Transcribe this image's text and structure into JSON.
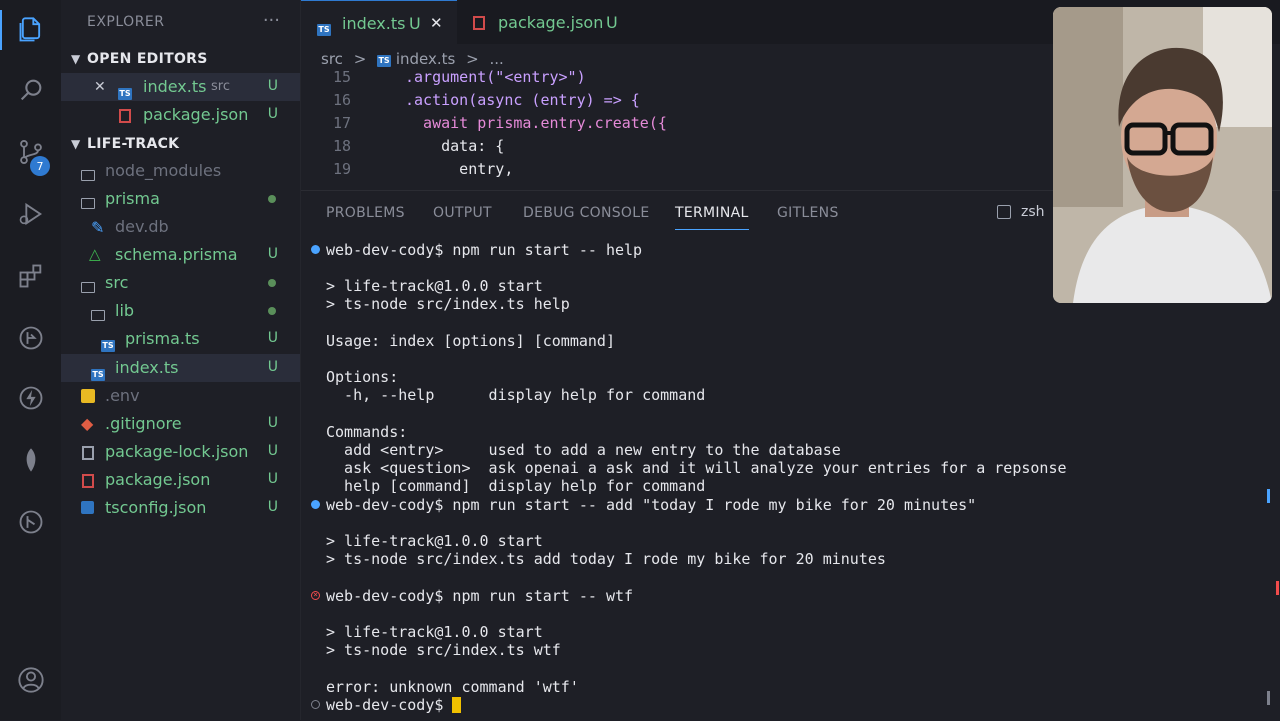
{
  "activity_bar": {
    "scm_badge": "7"
  },
  "sidebar": {
    "title": "EXPLORER",
    "more": "···",
    "open_editors": {
      "title": "OPEN EDITORS",
      "items": [
        {
          "close": "✕",
          "name": "index.ts",
          "hint": "src",
          "status": "U"
        },
        {
          "name": "package.json",
          "status": "U"
        }
      ]
    },
    "project": {
      "title": "LIFE-TRACK",
      "items": [
        {
          "name": "node_modules",
          "status": ""
        },
        {
          "name": "prisma",
          "status": "dot"
        },
        {
          "name": "dev.db",
          "status": ""
        },
        {
          "name": "schema.prisma",
          "status": "U"
        },
        {
          "name": "src",
          "status": "dot"
        },
        {
          "name": "lib",
          "status": "dot"
        },
        {
          "name": "prisma.ts",
          "status": "U"
        },
        {
          "name": "index.ts",
          "status": "U"
        },
        {
          "name": ".env",
          "status": ""
        },
        {
          "name": ".gitignore",
          "status": "U"
        },
        {
          "name": "package-lock.json",
          "status": "U"
        },
        {
          "name": "package.json",
          "status": "U"
        },
        {
          "name": "tsconfig.json",
          "status": "U"
        }
      ]
    }
  },
  "editor": {
    "tabs": [
      {
        "label": "index.ts",
        "status": "U",
        "close": "✕"
      },
      {
        "label": "package.json",
        "status": "U"
      }
    ],
    "breadcrumb": {
      "folder": "src",
      "sep": ">",
      "file": "index.ts",
      "sep2": ">",
      "more": "..."
    },
    "lines": [
      {
        "num": "15",
        "text": ".argument(\"<entry>\")"
      },
      {
        "num": "16",
        "text": ".action(async (entry) => {"
      },
      {
        "num": "17",
        "text": "  await prisma.entry.create({"
      },
      {
        "num": "18",
        "text": "    data: {"
      },
      {
        "num": "19",
        "text": "      entry,"
      }
    ]
  },
  "panel": {
    "tabs": [
      "PROBLEMS",
      "OUTPUT",
      "DEBUG CONSOLE",
      "TERMINAL",
      "GITLENS"
    ],
    "active_tab": "TERMINAL",
    "shell": "zsh",
    "terminal_lines": [
      "web-dev-cody$ npm run start -- help",
      "",
      "> life-track@1.0.0 start",
      "> ts-node src/index.ts help",
      "",
      "Usage: index [options] [command]",
      "",
      "Options:",
      "  -h, --help      display help for command",
      "",
      "Commands:",
      "  add <entry>     used to add a new entry to the database",
      "  ask <question>  ask openai a ask and it will analyze your entries for a repsonse",
      "  help [command]  display help for command",
      "web-dev-cody$ npm run start -- add \"today I rode my bike for 20 minutes\"",
      "",
      "> life-track@1.0.0 start",
      "> ts-node src/index.ts add today I rode my bike for 20 minutes",
      "",
      "web-dev-cody$ npm run start -- wtf",
      "",
      "> life-track@1.0.0 start",
      "> ts-node src/index.ts wtf",
      "",
      "error: unknown command 'wtf'",
      "web-dev-cody$ "
    ],
    "colors": {
      "ok_marker": "#4aa3ff",
      "error_marker": "#f14c4c",
      "idle_marker": "#7d808c",
      "cursor": "#f0c000"
    }
  }
}
